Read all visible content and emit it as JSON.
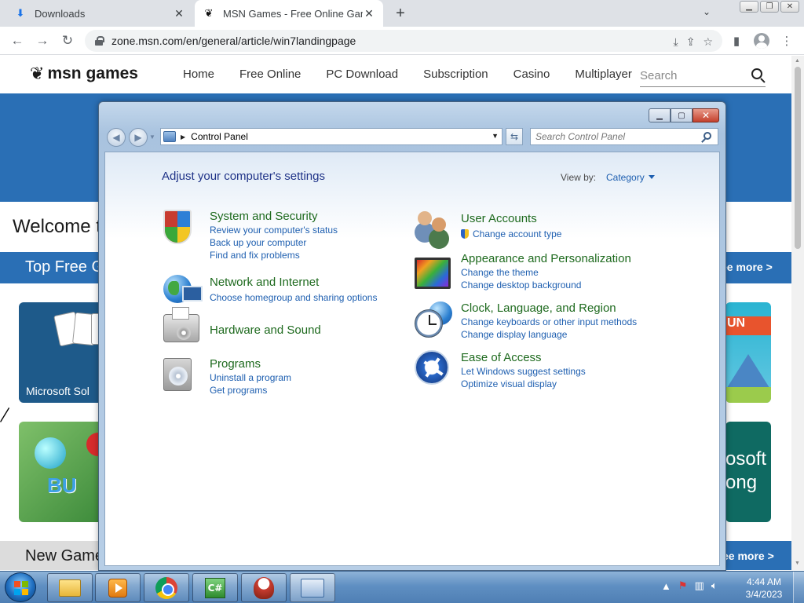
{
  "browser": {
    "tabs": [
      {
        "title": "Downloads",
        "icon": "download-icon",
        "active": false
      },
      {
        "title": "MSN Games - Free Online Games",
        "icon": "msn-butterfly-icon",
        "active": true
      }
    ],
    "new_tab": "+",
    "url": "zone.msn.com/en/general/article/win7landingpage"
  },
  "msn": {
    "logo": "msn games",
    "nav": [
      "Home",
      "Free Online",
      "PC Download",
      "Subscription",
      "Casino",
      "Multiplayer"
    ],
    "search_placeholder": "Search",
    "welcome": "Welcome t",
    "top_free_label": "Top Free G",
    "see_more": "ee more >",
    "new_games_label": "New Game",
    "tiles": {
      "solitaire_label": "Microsoft Sol",
      "bubble_word": "BU",
      "fun_banner": "UN",
      "mahjong_l1": "osoft",
      "mahjong_l2": "ong"
    }
  },
  "control_panel": {
    "address_crumb": "Control Panel",
    "search_placeholder": "Search Control Panel",
    "heading": "Adjust your computer's settings",
    "view_by_label": "View by:",
    "view_by_value": "Category",
    "left_categories": [
      {
        "title": "System and Security",
        "icon": "shield-icon",
        "links": [
          "Review your computer's status",
          "Back up your computer",
          "Find and fix problems"
        ]
      },
      {
        "title": "Network and Internet",
        "icon": "network-globe-icon",
        "links": [
          "Choose homegroup and sharing options"
        ]
      },
      {
        "title": "Hardware and Sound",
        "icon": "printer-icon",
        "links": []
      },
      {
        "title": "Programs",
        "icon": "programs-icon",
        "links": [
          "Uninstall a program",
          "Get programs"
        ]
      }
    ],
    "right_categories": [
      {
        "title": "User Accounts",
        "icon": "users-icon",
        "links": [
          "Change account type"
        ]
      },
      {
        "title": "Appearance and Personalization",
        "icon": "appearance-icon",
        "links": [
          "Change the theme",
          "Change desktop background"
        ]
      },
      {
        "title": "Clock, Language, and Region",
        "icon": "clock-globe-icon",
        "links": [
          "Change keyboards or other input methods",
          "Change display language"
        ]
      },
      {
        "title": "Ease of Access",
        "icon": "ease-of-access-icon",
        "links": [
          "Let Windows suggest settings",
          "Optimize visual display"
        ]
      }
    ]
  },
  "taskbar": {
    "apps": [
      "file-explorer",
      "media-player",
      "chrome",
      "csharp",
      "game",
      "control-panel"
    ],
    "time": "4:44 AM",
    "date": "3/4/2023"
  }
}
